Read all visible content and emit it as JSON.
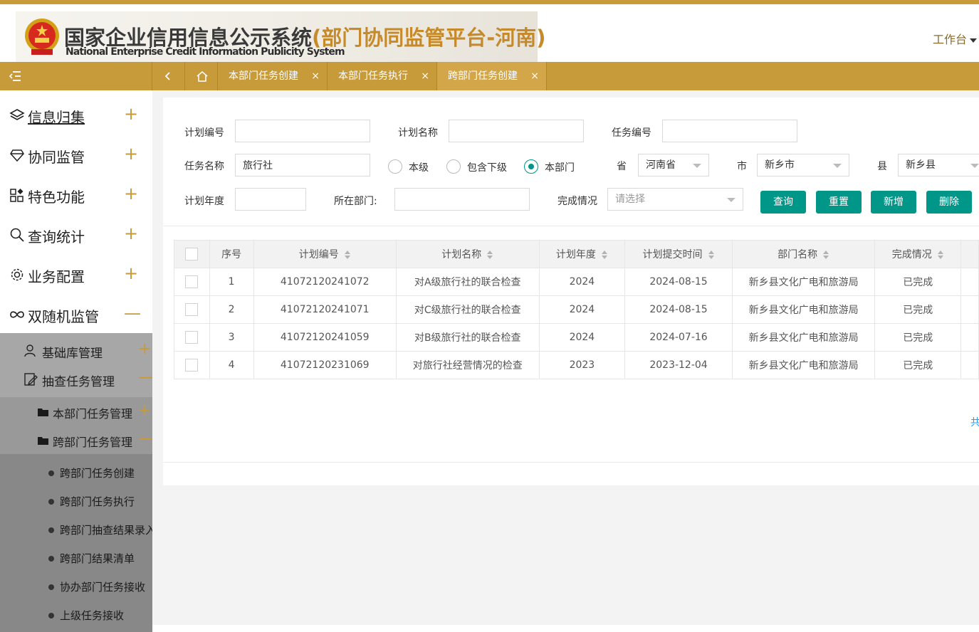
{
  "header": {
    "title_cn": "国家企业信用信息公示系统",
    "title_suffix": "(部门协同监管平台-河南)",
    "title_en": "National Enterprise Credit Information Publicity System",
    "workbench_label": "工作台"
  },
  "tabs": [
    {
      "label": "本部门任务创建",
      "close": "×"
    },
    {
      "label": "本部门任务执行",
      "close": "×"
    },
    {
      "label": "跨部门任务创建",
      "close": "×"
    }
  ],
  "sidebar": {
    "top_items": [
      {
        "label": "信息归集",
        "icon": "layers-icon",
        "toggle": "+"
      },
      {
        "label": "协同监管",
        "icon": "diamond-icon",
        "toggle": "+"
      },
      {
        "label": "特色功能",
        "icon": "apps-icon",
        "toggle": "+"
      },
      {
        "label": "查询统计",
        "icon": "search-icon",
        "toggle": "+"
      },
      {
        "label": "业务配置",
        "icon": "gear-icon",
        "toggle": "+"
      },
      {
        "label": "双随机监管",
        "icon": "infinity-icon",
        "toggle": "—"
      }
    ],
    "sub_items": [
      {
        "label": "基础库管理",
        "icon": "user-icon",
        "toggle": "+"
      },
      {
        "label": "抽查任务管理",
        "icon": "edit-doc-icon",
        "toggle": "—"
      }
    ],
    "sub3_items": [
      {
        "label": "本部门任务管理",
        "icon": "folder-icon",
        "toggle": "+"
      },
      {
        "label": "跨部门任务管理",
        "icon": "folder-icon",
        "toggle": "—"
      }
    ],
    "leaf_items": [
      {
        "label": "跨部门任务创建"
      },
      {
        "label": "跨部门任务执行"
      },
      {
        "label": "跨部门抽查结果录入"
      },
      {
        "label": "跨部门结果清单"
      },
      {
        "label": "协办部门任务接收"
      },
      {
        "label": "上级任务接收"
      }
    ]
  },
  "form": {
    "plan_no_label": "计划编号",
    "plan_no_value": "",
    "plan_name_label": "计划名称",
    "plan_name_value": "",
    "task_no_label": "任务编号",
    "task_no_value": "",
    "task_name_label": "任务名称",
    "task_name_value": "旅行社",
    "radio_level": "本级",
    "radio_include_sub": "包含下级",
    "radio_dept": "本部门",
    "province_label": "省",
    "province_value": "河南省",
    "city_label": "市",
    "city_value": "新乡市",
    "county_label": "县",
    "county_value": "新乡县",
    "year_label": "计划年度",
    "year_value": "",
    "dept_label": "所在部门:",
    "dept_value": "",
    "status_label": "完成情况",
    "status_placeholder": "请选择",
    "btn_query": "查询",
    "btn_reset": "重置",
    "btn_add": "新增",
    "btn_delete": "删除"
  },
  "table": {
    "headers": [
      "序号",
      "计划编号",
      "计划名称",
      "计划年度",
      "计划提交时间",
      "部门名称",
      "完成情况"
    ],
    "rows": [
      [
        "1",
        "41072120241072",
        "对A级旅行社的联合检查",
        "2024",
        "2024-08-15",
        "新乡县文化广电和旅游局",
        "已完成"
      ],
      [
        "2",
        "41072120241071",
        "对C级旅行社的联合检查",
        "2024",
        "2024-08-15",
        "新乡县文化广电和旅游局",
        "已完成"
      ],
      [
        "3",
        "41072120241059",
        "对B级旅行社的联合检查",
        "2024",
        "2024-07-16",
        "新乡县文化广电和旅游局",
        "已完成"
      ],
      [
        "4",
        "41072120231069",
        "对旅行社经营情况的检查",
        "2023",
        "2023-12-04",
        "新乡县文化广电和旅游局",
        "已完成"
      ]
    ]
  },
  "pager": {
    "total_prefix": "共"
  }
}
